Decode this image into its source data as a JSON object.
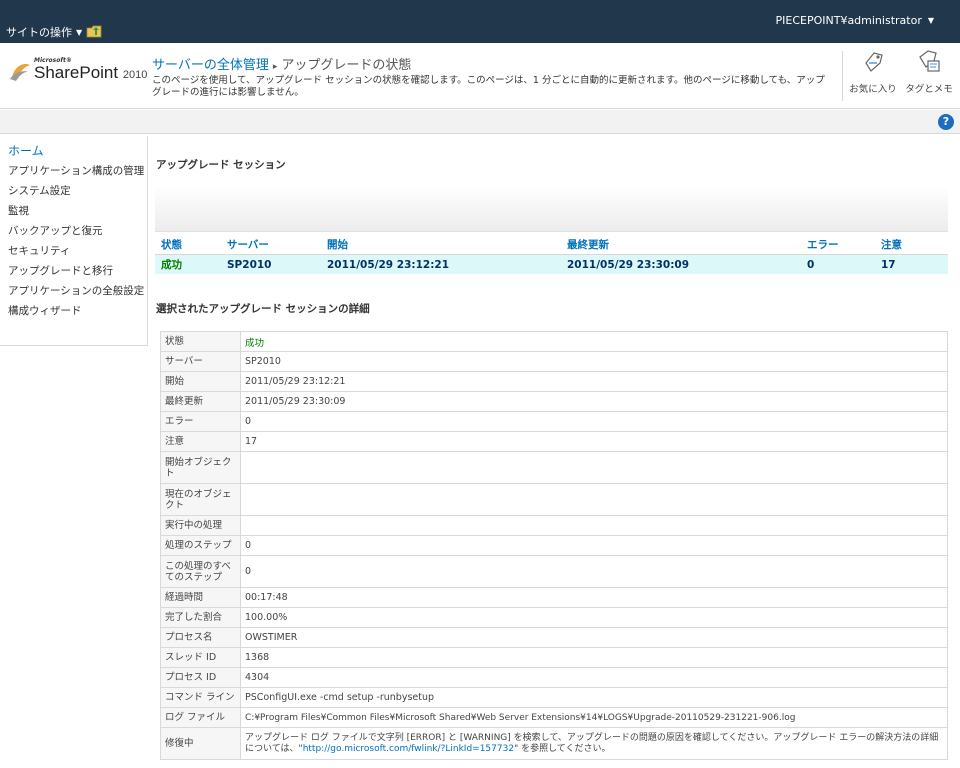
{
  "ribbon": {
    "site_actions": "サイトの操作",
    "user": "PIECEPOINT¥administrator"
  },
  "logo": {
    "small": "Microsoft®",
    "name": "SharePoint",
    "version": "2010"
  },
  "breadcrumb": {
    "root": "サーバーの全体管理",
    "separator": "▸",
    "current": "アップグレードの状態"
  },
  "description": "このページを使用して、アップグレード セッションの状態を確認します。このページは、1 分ごとに自動的に更新されます。他のページに移動しても、アップグレードの進行には影響しません。",
  "tools": {
    "favorites": "お気に入り",
    "tags": "タグとメモ"
  },
  "icons": {
    "help": "?",
    "help_name": "help-icon",
    "nav": "folder-up-icon"
  },
  "leftnav": [
    "ホーム",
    "アプリケーション構成の管理",
    "システム設定",
    "監視",
    "バックアップと復元",
    "セキュリティ",
    "アップグレードと移行",
    "アプリケーションの全般設定",
    "構成ウィザード"
  ],
  "sessions": {
    "title": "アップグレード セッション",
    "headers": [
      "状態",
      "サーバー",
      "開始",
      "最終更新",
      "エラー",
      "注意"
    ],
    "rows": [
      [
        "成功",
        "SP2010",
        "2011/05/29 23:12:21",
        "2011/05/29 23:30:09",
        "0",
        "17"
      ]
    ]
  },
  "details": {
    "title": "選択されたアップグレード セッションの詳細",
    "rows": [
      {
        "label": "状態",
        "value": "成功"
      },
      {
        "label": "サーバー",
        "value": "SP2010"
      },
      {
        "label": "開始",
        "value": "2011/05/29 23:12:21"
      },
      {
        "label": "最終更新",
        "value": "2011/05/29 23:30:09"
      },
      {
        "label": "エラー",
        "value": "0"
      },
      {
        "label": "注意",
        "value": "17"
      },
      {
        "label": "開始オブジェクト",
        "value": ""
      },
      {
        "label": "現在のオブジェクト",
        "value": ""
      },
      {
        "label": "実行中の処理",
        "value": ""
      },
      {
        "label": "処理のステップ",
        "value": "0"
      },
      {
        "label": "この処理のすべてのステップ",
        "value": "0"
      },
      {
        "label": "経過時間",
        "value": "00:17:48"
      },
      {
        "label": "完了した割合",
        "value": "100.00%"
      },
      {
        "label": "プロセス名",
        "value": "OWSTIMER"
      },
      {
        "label": "スレッド ID",
        "value": "1368"
      },
      {
        "label": "プロセス ID",
        "value": "4304"
      },
      {
        "label": "コマンド ライン",
        "value": "PSConfigUI.exe -cmd setup -runbysetup"
      },
      {
        "label": "ログ ファイル",
        "value": "C:¥Program Files¥Common Files¥Microsoft Shared¥Web Server Extensions¥14¥LOGS¥Upgrade-20110529-231221-906.log"
      }
    ],
    "remedy": {
      "label": "修復中",
      "text_before": "アップグレード ログ ファイルで文字列 [ERROR] と [WARNING] を検索して、アップグレードの問題の原因を確認してください。アップグレード エラーの解決方法の詳細については、\"",
      "link": "http://go.microsoft.com/fwlink/?LinkId=157732",
      "text_after": "\" を参照してください。"
    }
  }
}
